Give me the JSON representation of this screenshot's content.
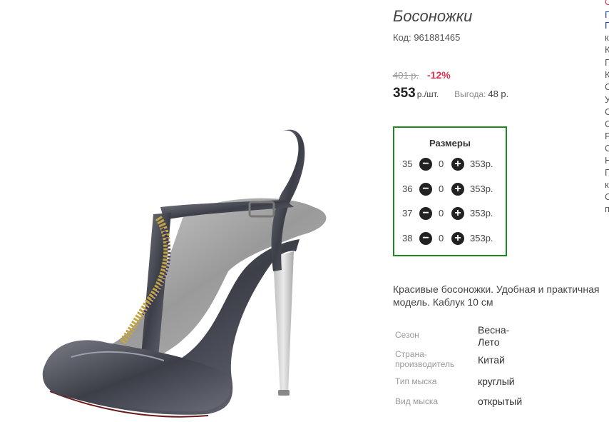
{
  "product": {
    "title": "Босоножки",
    "sku": "Код: 961881465",
    "image_icon": "sandal-product-image"
  },
  "pricing": {
    "old_price": "401 р.",
    "discount": "-12%",
    "price": "353",
    "price_unit": "р./шт.",
    "savings_label": "Выгода:",
    "savings_value": "48 р."
  },
  "sizes": {
    "title": "Размеры",
    "minus_icon": "minus-circle-icon",
    "plus_icon": "plus-circle-icon",
    "rows": [
      {
        "size": "35",
        "qty": "0",
        "price": "353р."
      },
      {
        "size": "36",
        "qty": "0",
        "price": "353р."
      },
      {
        "size": "37",
        "qty": "0",
        "price": "353р."
      },
      {
        "size": "38",
        "qty": "0",
        "price": "353р."
      }
    ]
  },
  "description": "Красивые босоножки. Удобная и практичная модель. Каблук 10 см",
  "attributes": [
    {
      "label": "Сезон",
      "value": "Весна-Лето"
    },
    {
      "label": "Страна-производитель",
      "value": "Китай"
    },
    {
      "label": "Тип мыска",
      "value": "круглый"
    },
    {
      "label": "Вид мыска",
      "value": "открытый"
    }
  ],
  "right_edge_letters": [
    "С",
    "Г",
    "Г",
    "к",
    "К",
    "Г",
    "К",
    "С",
    "У",
    "С",
    "С",
    "Р",
    "С",
    "Н",
    "Г",
    "к",
    "С",
    "п"
  ],
  "colors": {
    "discount": "#e2304f",
    "sizes_border": "#1a8a1a",
    "first_edge_letter": "#e2304f",
    "link_edge_letters": "#1a3fbf"
  }
}
